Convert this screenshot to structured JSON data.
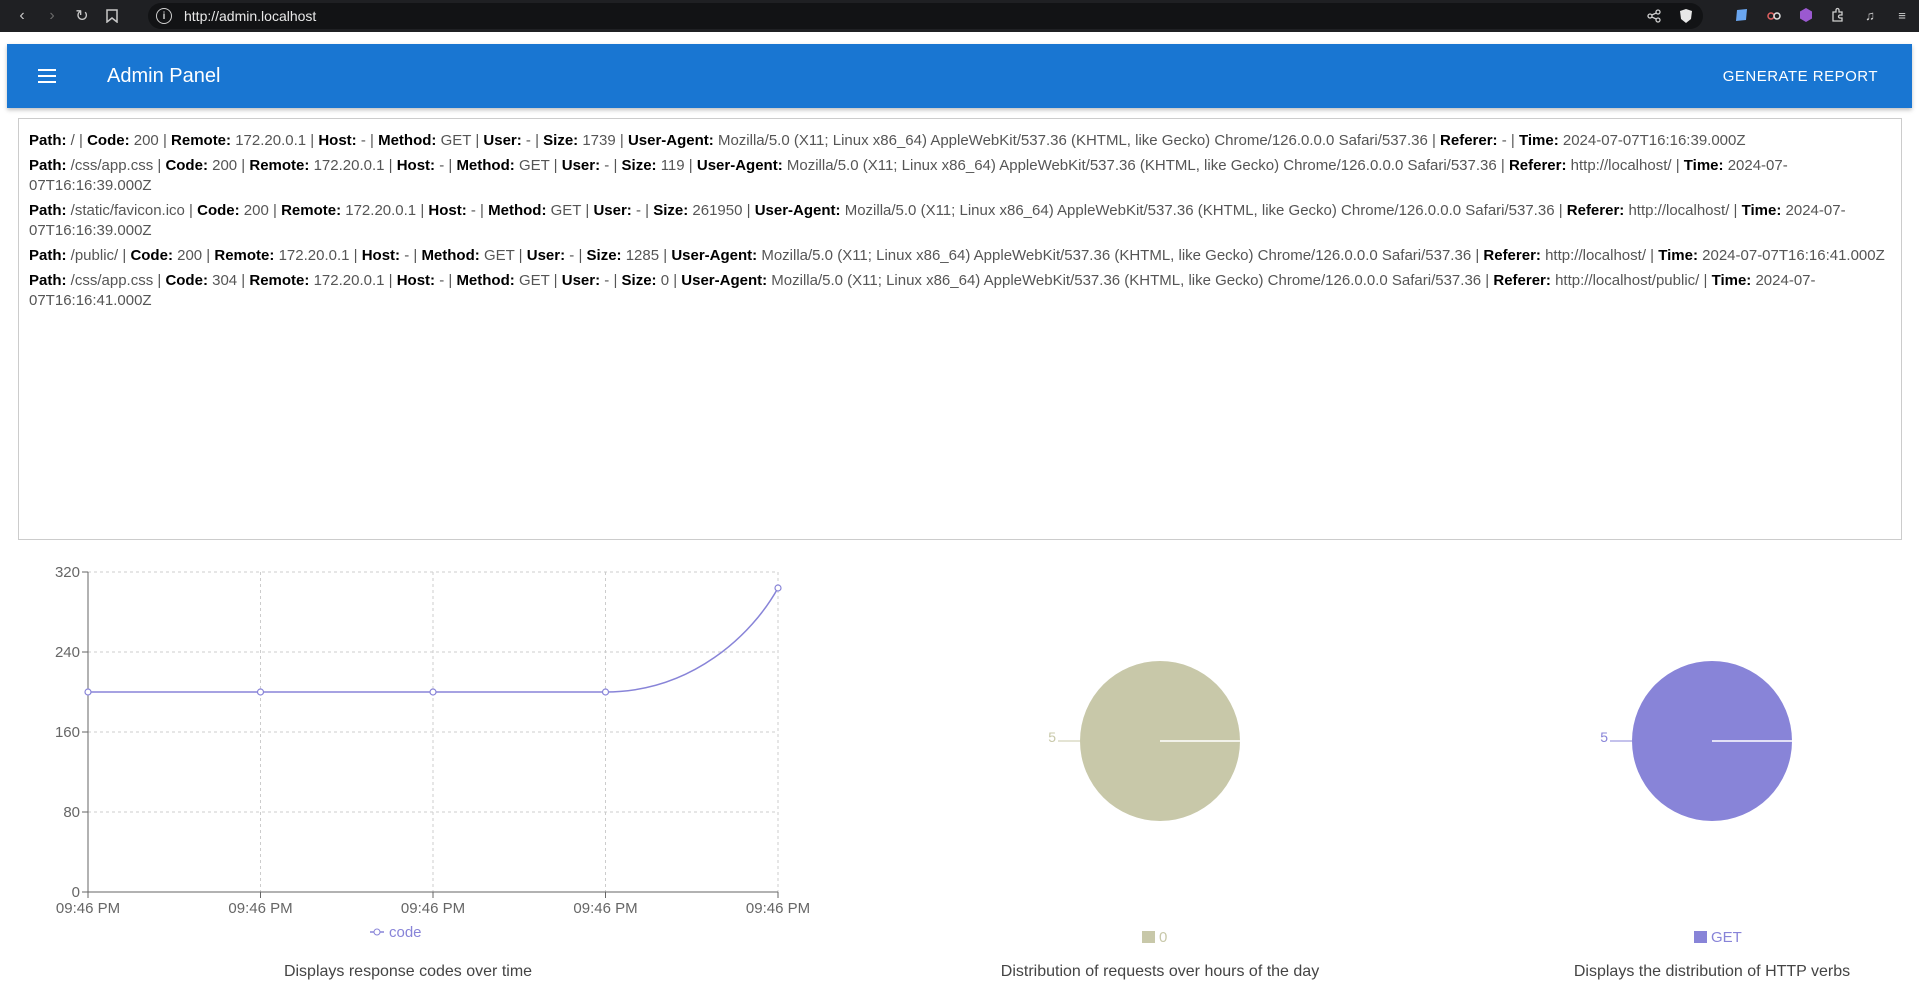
{
  "browser": {
    "url": "http://admin.localhost",
    "icons": [
      "back-icon",
      "forward-icon",
      "reload-icon",
      "bookmark-icon",
      "info-icon",
      "share-icon",
      "brave-shield-icon",
      "extension-icon-1",
      "extension-icon-2",
      "extension-icon-3",
      "puzzle-icon",
      "music-icon",
      "menu-icon"
    ]
  },
  "app_bar": {
    "title": "Admin Panel",
    "action_label": "GENERATE REPORT",
    "color": "#1976d2"
  },
  "logs": [
    {
      "path": "/",
      "code": "200",
      "remote": "172.20.0.1",
      "host": "-",
      "method": "GET",
      "user": "-",
      "size": "1739",
      "user_agent": "Mozilla/5.0 (X11; Linux x86_64) AppleWebKit/537.36 (KHTML, like Gecko) Chrome/126.0.0.0 Safari/537.36",
      "referer": "-",
      "time": "2024-07-07T16:16:39.000Z"
    },
    {
      "path": "/css/app.css",
      "code": "200",
      "remote": "172.20.0.1",
      "host": "-",
      "method": "GET",
      "user": "-",
      "size": "119",
      "user_agent": "Mozilla/5.0 (X11; Linux x86_64) AppleWebKit/537.36 (KHTML, like Gecko) Chrome/126.0.0.0 Safari/537.36",
      "referer": "http://localhost/",
      "time": "2024-07-07T16:16:39.000Z"
    },
    {
      "path": "/static/favicon.ico",
      "code": "200",
      "remote": "172.20.0.1",
      "host": "-",
      "method": "GET",
      "user": "-",
      "size": "261950",
      "user_agent": "Mozilla/5.0 (X11; Linux x86_64) AppleWebKit/537.36 (KHTML, like Gecko) Chrome/126.0.0.0 Safari/537.36",
      "referer": "http://localhost/",
      "time": "2024-07-07T16:16:39.000Z"
    },
    {
      "path": "/public/",
      "code": "200",
      "remote": "172.20.0.1",
      "host": "-",
      "method": "GET",
      "user": "-",
      "size": "1285",
      "user_agent": "Mozilla/5.0 (X11; Linux x86_64) AppleWebKit/537.36 (KHTML, like Gecko) Chrome/126.0.0.0 Safari/537.36",
      "referer": "http://localhost/",
      "time": "2024-07-07T16:16:41.000Z"
    },
    {
      "path": "/css/app.css",
      "code": "304",
      "remote": "172.20.0.1",
      "host": "-",
      "method": "GET",
      "user": "-",
      "size": "0",
      "user_agent": "Mozilla/5.0 (X11; Linux x86_64) AppleWebKit/537.36 (KHTML, like Gecko) Chrome/126.0.0.0 Safari/537.36",
      "referer": "http://localhost/public/",
      "time": "2024-07-07T16:16:41.000Z"
    }
  ],
  "log_labels": {
    "path": "Path:",
    "code": "Code:",
    "remote": "Remote:",
    "host": "Host:",
    "method": "Method:",
    "user": "User:",
    "size": "Size:",
    "user_agent": "User-Agent:",
    "referer": "Referer:",
    "time": "Time:"
  },
  "chart_data": [
    {
      "type": "line",
      "x": [
        "09:46 PM",
        "09:46 PM",
        "09:46 PM",
        "09:46 PM",
        "09:46 PM"
      ],
      "series": [
        {
          "name": "code",
          "values": [
            200,
            200,
            200,
            200,
            304
          ],
          "color": "#8884d8"
        }
      ],
      "yticks": [
        0,
        80,
        160,
        240,
        320
      ],
      "ylim": [
        0,
        320
      ],
      "grid": true,
      "legend": "bottom",
      "caption": "Displays response codes over time"
    },
    {
      "type": "pie",
      "slices": [
        {
          "name": "0",
          "value": 5,
          "color": "#c8c8a9"
        }
      ],
      "legend": "bottom",
      "caption": "Distribution of requests over hours of the day"
    },
    {
      "type": "pie",
      "slices": [
        {
          "name": "GET",
          "value": 5,
          "color": "#8884d8"
        }
      ],
      "legend": "bottom",
      "caption": "Displays the distribution of HTTP verbs"
    }
  ]
}
